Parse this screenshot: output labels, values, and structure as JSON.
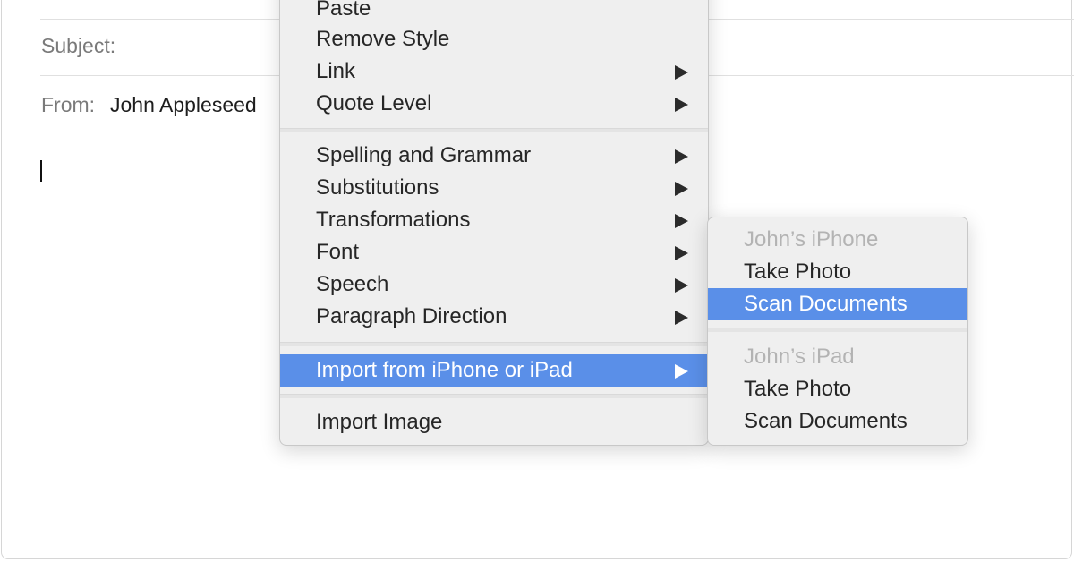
{
  "compose": {
    "subject_label": "Subject:",
    "subject_value": "",
    "from_label": "From:",
    "from_value": "John Appleseed",
    "body_text": ""
  },
  "context_menu": {
    "items": [
      {
        "label": "Paste",
        "has_submenu": false
      },
      {
        "label": "Remove Style",
        "has_submenu": false
      },
      {
        "label": "Link",
        "has_submenu": true
      },
      {
        "label": "Quote Level",
        "has_submenu": true
      },
      {
        "label": "Spelling and Grammar",
        "has_submenu": true
      },
      {
        "label": "Substitutions",
        "has_submenu": true
      },
      {
        "label": "Transformations",
        "has_submenu": true
      },
      {
        "label": "Font",
        "has_submenu": true
      },
      {
        "label": "Speech",
        "has_submenu": true
      },
      {
        "label": "Paragraph Direction",
        "has_submenu": true
      },
      {
        "label": "Import from iPhone or iPad",
        "has_submenu": true,
        "highlighted": true
      },
      {
        "label": "Import Image",
        "has_submenu": false
      }
    ],
    "highlight_color": "#5a8fe8"
  },
  "submenu": {
    "groups": [
      {
        "device": "John’s iPhone",
        "items": [
          {
            "label": "Take Photo"
          },
          {
            "label": "Scan Documents",
            "highlighted": true
          }
        ]
      },
      {
        "device": "John’s iPad",
        "items": [
          {
            "label": "Take Photo"
          },
          {
            "label": "Scan Documents"
          }
        ]
      }
    ]
  }
}
